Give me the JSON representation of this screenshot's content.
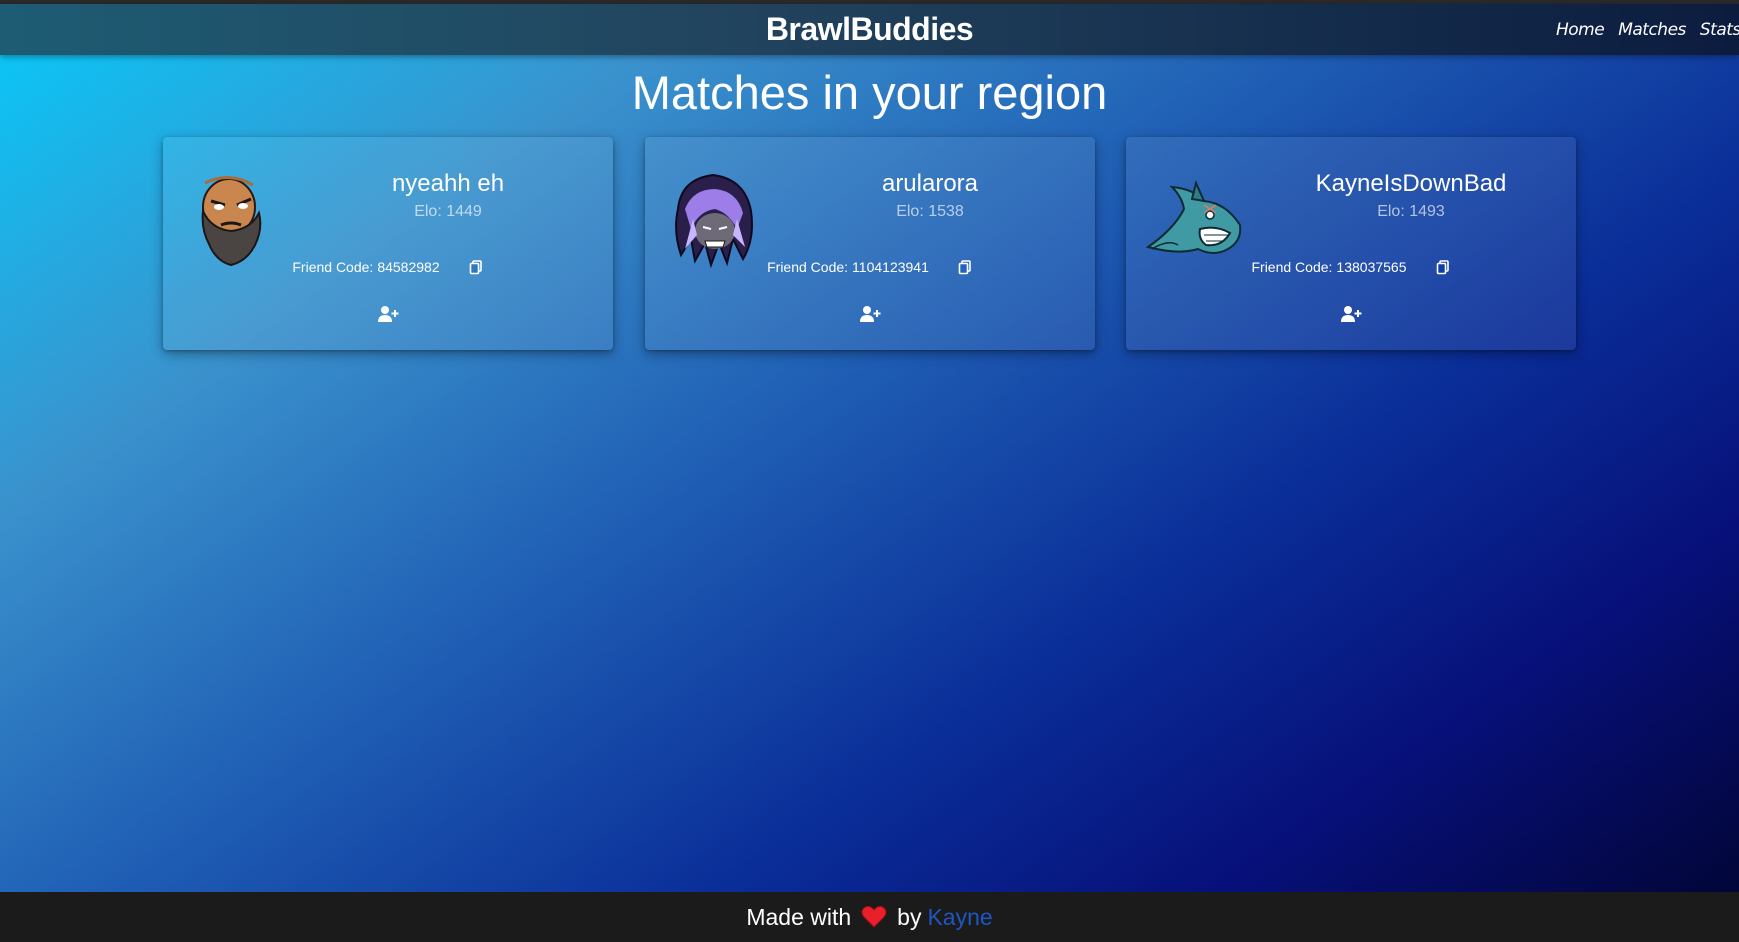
{
  "navbar": {
    "brand": "BrawlBuddies",
    "links": [
      "Home",
      "Matches",
      "Stats"
    ]
  },
  "page": {
    "title": "Matches in your region"
  },
  "cards": [
    {
      "name": "nyeahh eh",
      "elo": "Elo: 1449",
      "friend_label": "Friend Code:",
      "friend_code": "84582982",
      "avatar_icon": "bearded-warrior-icon"
    },
    {
      "name": "arularora",
      "elo": "Elo: 1538",
      "friend_label": "Friend Code:",
      "friend_code": "1104123941",
      "avatar_icon": "purple-hair-warrior-icon"
    },
    {
      "name": "KayneIsDownBad",
      "elo": "Elo: 1493",
      "friend_label": "Friend Code:",
      "friend_code": "138037565",
      "avatar_icon": "shark-icon"
    }
  ],
  "footer": {
    "made_with": "Made with",
    "by": "by",
    "author": "Kayne"
  },
  "colors": {
    "gradient_start": "#0cc4f5",
    "gradient_end": "#020538",
    "footer_bg": "#1b1b1b",
    "author_link": "#1f56c2",
    "heart": "#e8202a"
  }
}
